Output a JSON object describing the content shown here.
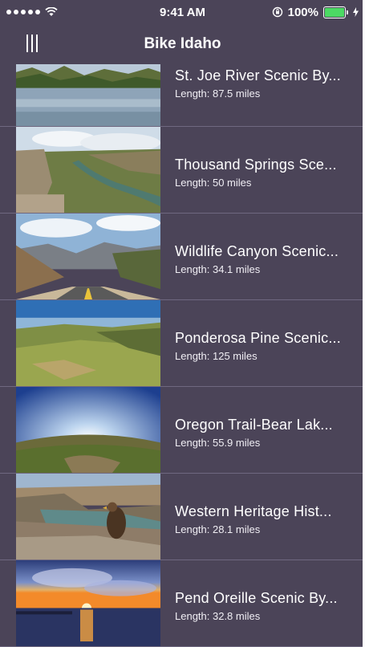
{
  "status_bar": {
    "time": "9:41 AM",
    "battery_percent": "100%",
    "battery_level": 1.0,
    "signal_bars": 5
  },
  "nav": {
    "title": "Bike Idaho",
    "menu_icon": "hamburger-menu-icon"
  },
  "routes": [
    {
      "name": "St. Joe River Scenic By...",
      "length": "Length: 87.5 miles",
      "image": "river-forest"
    },
    {
      "name": "Thousand Springs Sce...",
      "length": "Length: 50 miles",
      "image": "canyon-river"
    },
    {
      "name": "Wildlife Canyon Scenic...",
      "length": "Length: 34.1 miles",
      "image": "mountain-road"
    },
    {
      "name": "Ponderosa Pine Scenic...",
      "length": "Length: 125 miles",
      "image": "pine-hills"
    },
    {
      "name": "Oregon Trail-Bear Lak...",
      "length": "Length: 55.9 miles",
      "image": "fisheye-valley"
    },
    {
      "name": "Western Heritage Hist...",
      "length": "Length: 28.1 miles",
      "image": "eagle-canyon"
    },
    {
      "name": "Pend Oreille Scenic By...",
      "length": "Length: 32.8 miles",
      "image": "lake-sunset"
    }
  ],
  "colors": {
    "background": "#4b4458",
    "divider": "#6f6880",
    "battery": "#4cd964"
  }
}
